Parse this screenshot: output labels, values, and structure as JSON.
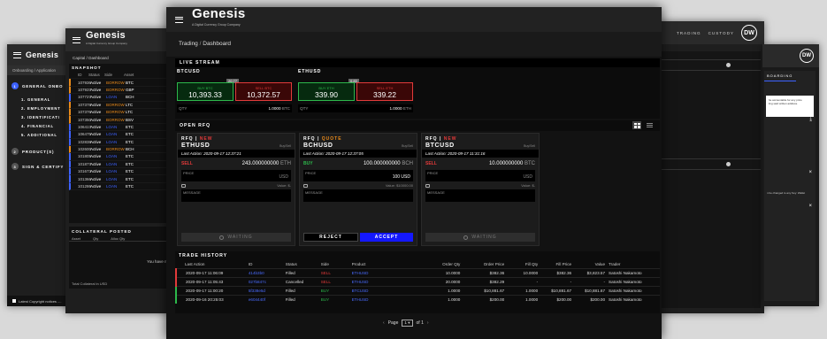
{
  "brand": {
    "name": "Genesis",
    "tagline": "A Digital Currency Group Company"
  },
  "screen_left": {
    "breadcrumb": [
      "Onboarding",
      "Application"
    ],
    "steps": [
      {
        "num": "1",
        "label": "GENERAL ONBO"
      },
      {
        "num": "2",
        "label": "PRODUCT(S)"
      },
      {
        "num": "3",
        "label": "SIGN & CERTIFY"
      }
    ],
    "substeps": [
      "1. GENERAL",
      "2. EMPLOYMENT",
      "3. IDENTIFICATI",
      "4. FINANCIAL",
      "5. ADDITIONAL"
    ],
    "footer": "Latest Copyright notices ...."
  },
  "screen_second": {
    "breadcrumb": [
      "Capital",
      "Dashboard"
    ],
    "snapshot_title": "SNAPSHOT",
    "columns": [
      "ID",
      "Status",
      "Side",
      "Asset"
    ],
    "rows": [
      {
        "id": "107936",
        "status": "Active",
        "side": "BORROW",
        "asset": "BTC"
      },
      {
        "id": "107937",
        "status": "Active",
        "side": "BORROW",
        "asset": "GBP"
      },
      {
        "id": "107727",
        "status": "Active",
        "side": "LOAN",
        "asset": "BCH"
      },
      {
        "id": "107378",
        "status": "Active",
        "side": "BORROW",
        "asset": "LTC"
      },
      {
        "id": "107376",
        "status": "Active",
        "side": "BORROW",
        "asset": "LTC"
      },
      {
        "id": "107350",
        "status": "Active",
        "side": "BORROW",
        "asset": "BSV"
      },
      {
        "id": "106417",
        "status": "Active",
        "side": "LOAN",
        "asset": "ETC"
      },
      {
        "id": "106475",
        "status": "Active",
        "side": "LOAN",
        "asset": "ETC"
      },
      {
        "id": "102838",
        "status": "Active",
        "side": "LOAN",
        "asset": "ETC"
      },
      {
        "id": "102600",
        "status": "Active",
        "side": "BORROW",
        "asset": "BCH"
      },
      {
        "id": "101805",
        "status": "Active",
        "side": "LOAN",
        "asset": "ETC"
      },
      {
        "id": "101877",
        "status": "Active",
        "side": "LOAN",
        "asset": "ETC"
      },
      {
        "id": "101673",
        "status": "Active",
        "side": "LOAN",
        "asset": "ETC"
      },
      {
        "id": "101366",
        "status": "Active",
        "side": "LOAN",
        "asset": "ETC"
      },
      {
        "id": "101286",
        "status": "Active",
        "side": "LOAN",
        "asset": "ETC"
      }
    ],
    "collateral_title": "COLLATERAL POSTED",
    "collateral_cols": [
      "Asset",
      "Qty",
      "Alloc Qty"
    ],
    "collateral_empty": "You have no",
    "collateral_total": "Total Collateral in USD"
  },
  "screen_right": {
    "nav": [
      "TRADING",
      "CUSTODY"
    ],
    "avatar": "DW",
    "inner_tab": "BOARDING",
    "note_lines": [
      "he accountable for any price",
      "ling said written address."
    ],
    "note2": "n be changed to any Key: Wallet"
  },
  "main": {
    "breadcrumb": [
      "Trading",
      "Dashboard"
    ],
    "live_stream": {
      "title": "LIVE STREAM",
      "pairs": [
        {
          "symbol": "BTCUSD",
          "spread": "20.77",
          "buy_label": "BUY BTC",
          "buy_price": "10,393.33",
          "sell_label": "SELL BTC",
          "sell_price": "10,372.57",
          "qty_label": "QTY",
          "qty": "1.0000",
          "qty_unit": "BTC"
        },
        {
          "symbol": "ETHUSD",
          "spread": "0.83",
          "buy_label": "BUY ETH",
          "buy_price": "339.90",
          "sell_label": "SELL ETH",
          "sell_price": "339.22",
          "qty_label": "QTY",
          "qty": "1.0000",
          "qty_unit": "ETH"
        }
      ]
    },
    "open_rfq": {
      "title": "OPEN RFQ",
      "cards": [
        {
          "header": "RFQ",
          "state": "NEW",
          "symbol": "ETHUSD",
          "dir": "Buy/Sell",
          "last_action": "Last Action: 2020-09-17 12:37:21",
          "side": "SELL",
          "qty": "243.000000000",
          "unit": "ETH",
          "price_label": "PRICE",
          "price_value": "USD",
          "value_label": "Value: $-",
          "message_label": "MESSAGE",
          "action": "WAITING"
        },
        {
          "header": "RFQ",
          "state": "QUOTE",
          "symbol": "BCHUSD",
          "dir": "Buy/Sell",
          "last_action": "Last Action: 2020-09-17 12:37:05",
          "side": "BUY",
          "qty": "100.000000000",
          "unit": "BCH",
          "price_label": "PRICE",
          "price_value": "100 USD",
          "value_label": "Value: $10000.00",
          "message_label": "MESSAGE",
          "reject": "REJECT",
          "accept": "ACCEPT"
        },
        {
          "header": "RFQ",
          "state": "NEW",
          "symbol": "BTCUSD",
          "dir": "Buy/Sell",
          "last_action": "Last Action: 2020-09-17 11:31:16",
          "side": "SELL",
          "qty": "10.000000000",
          "unit": "BTC",
          "price_label": "PRICE",
          "price_value": "USD",
          "value_label": "Value: $-",
          "message_label": "MESSAGE",
          "action": "WAITING"
        }
      ]
    },
    "trade_history": {
      "title": "TRADE HISTORY",
      "columns": [
        "Last Action",
        "ID",
        "Status",
        "Side",
        "Product",
        "Order Qty",
        "Order Price",
        "Fill Qty",
        "Fill Price",
        "Value",
        "Trader"
      ],
      "rows": [
        {
          "last": "2020-09-17 11:06:09",
          "id": "414b3b0",
          "status": "Filled",
          "side": "SELL",
          "product": "ETHUSD",
          "oqty": "10.0000",
          "oprice": "$382.36",
          "fqty": "10.0000",
          "fprice": "$382.36",
          "value": "$3,823.57",
          "trader": "Satoshi Nakamoto",
          "marker": "#e23a3a"
        },
        {
          "last": "2020-09-17 11:05:43",
          "id": "027b847c",
          "status": "Cancelled",
          "side": "SELL",
          "product": "ETHUSD",
          "oqty": "20.0000",
          "oprice": "$382.29",
          "fqty": "-",
          "fprice": "-",
          "value": "-",
          "trader": "Satoshi Nakamoto",
          "marker": "#e23a3a"
        },
        {
          "last": "2020-09-17 11:00:20",
          "id": "5f338e5d",
          "status": "Filled",
          "side": "BUY",
          "product": "BTCUSD",
          "oqty": "1.0000",
          "oprice": "$10,881.67",
          "fqty": "1.0000",
          "fprice": "$10,881.67",
          "value": "$10,881.67",
          "trader": "Satoshi Nakamoto",
          "marker": "#2db84b"
        },
        {
          "last": "2020-09-16 20:25:03",
          "id": "e604440f",
          "status": "Filled",
          "side": "BUY",
          "product": "ETHUSD",
          "oqty": "1.0000",
          "oprice": "$200.00",
          "fqty": "1.0000",
          "fprice": "$200.00",
          "value": "$200.00",
          "trader": "Satoshi Nakamoto",
          "marker": "#2db84b"
        }
      ]
    },
    "pagination": {
      "label": "Page",
      "current": "1",
      "of": "of 1"
    }
  },
  "colors": {
    "green": "#2db84b",
    "red": "#e23a3a",
    "blue": "#4a6cff",
    "accept": "#1418ff",
    "orange": "#e98a1a",
    "accent_blue": "#3d62ff"
  }
}
